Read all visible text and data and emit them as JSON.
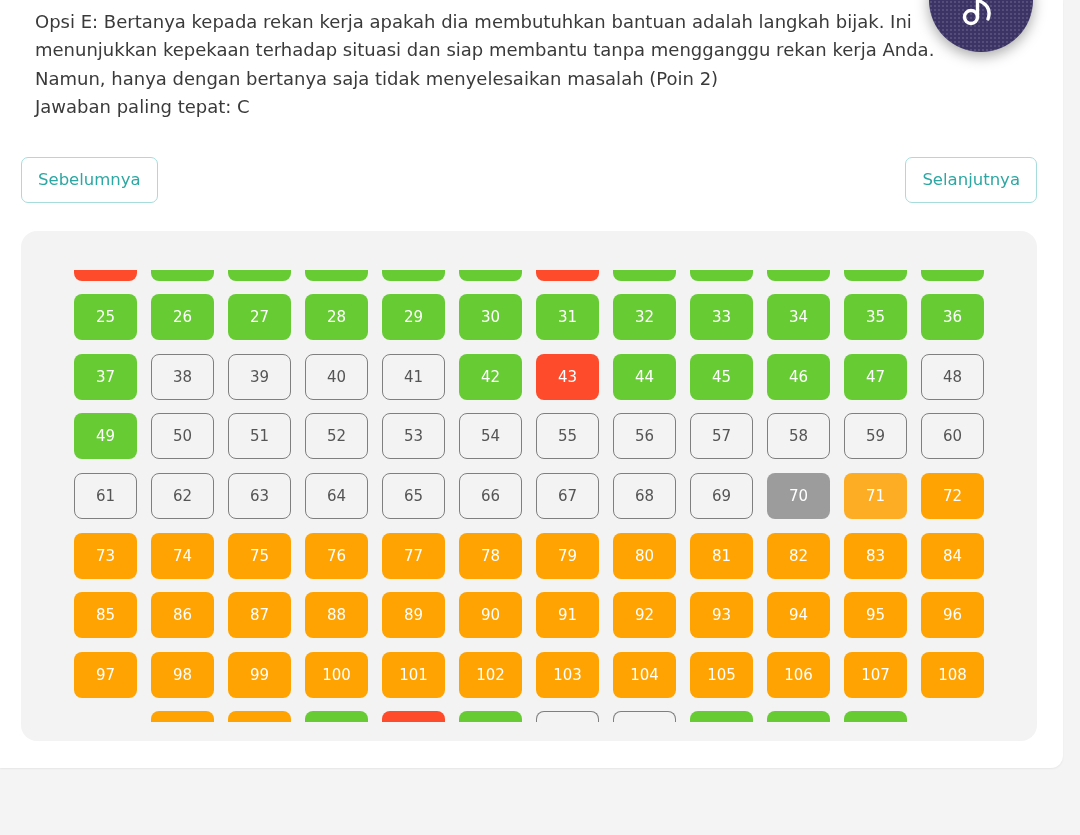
{
  "explanation": {
    "paragraphs": [
      "Opsi E: Bertanya kepada rekan kerja apakah dia membutuhkan bantuan adalah langkah bijak. Ini menunjukkan kepekaan terhadap situasi dan siap membantu tanpa mengganggu rekan kerja Anda. Namun, hanya dengan bertanya saja tidak menyelesaikan masalah (Poin 2)",
      "Jawaban paling tepat: C"
    ]
  },
  "navigation": {
    "previous": "Sebelumnya",
    "next": "Selanjutnya"
  },
  "question_grid": {
    "top_cut_row": [
      {
        "kind": "filled",
        "color": "#fd4b2b"
      },
      {
        "kind": "filled",
        "color": "#67cb34"
      },
      {
        "kind": "filled",
        "color": "#67cb34"
      },
      {
        "kind": "filled",
        "color": "#67cb34"
      },
      {
        "kind": "filled",
        "color": "#67cb34"
      },
      {
        "kind": "filled",
        "color": "#67cb34"
      },
      {
        "kind": "filled",
        "color": "#fd4b2b"
      },
      {
        "kind": "filled",
        "color": "#67cb34"
      },
      {
        "kind": "filled",
        "color": "#67cb34"
      },
      {
        "kind": "filled",
        "color": "#67cb34"
      },
      {
        "kind": "filled",
        "color": "#67cb34"
      },
      {
        "kind": "filled",
        "color": "#67cb34"
      }
    ],
    "tiles": [
      {
        "label": "25",
        "kind": "filled",
        "color": "#67cb34"
      },
      {
        "label": "26",
        "kind": "filled",
        "color": "#67cb34"
      },
      {
        "label": "27",
        "kind": "filled",
        "color": "#67cb34"
      },
      {
        "label": "28",
        "kind": "filled",
        "color": "#67cb34"
      },
      {
        "label": "29",
        "kind": "filled",
        "color": "#67cb34"
      },
      {
        "label": "30",
        "kind": "filled",
        "color": "#67cb34"
      },
      {
        "label": "31",
        "kind": "filled",
        "color": "#67cb34"
      },
      {
        "label": "32",
        "kind": "filled",
        "color": "#67cb34"
      },
      {
        "label": "33",
        "kind": "filled",
        "color": "#67cb34"
      },
      {
        "label": "34",
        "kind": "filled",
        "color": "#67cb34"
      },
      {
        "label": "35",
        "kind": "filled",
        "color": "#67cb34"
      },
      {
        "label": "36",
        "kind": "filled",
        "color": "#67cb34"
      },
      {
        "label": "37",
        "kind": "filled",
        "color": "#67cb34"
      },
      {
        "label": "38",
        "kind": "outline",
        "color": "#7f7f7f"
      },
      {
        "label": "39",
        "kind": "outline",
        "color": "#7f7f7f"
      },
      {
        "label": "40",
        "kind": "outline",
        "color": "#7f7f7f"
      },
      {
        "label": "41",
        "kind": "outline",
        "color": "#7f7f7f"
      },
      {
        "label": "42",
        "kind": "filled",
        "color": "#67cb34"
      },
      {
        "label": "43",
        "kind": "filled",
        "color": "#fd4b2b"
      },
      {
        "label": "44",
        "kind": "filled",
        "color": "#67cb34"
      },
      {
        "label": "45",
        "kind": "filled",
        "color": "#67cb34"
      },
      {
        "label": "46",
        "kind": "filled",
        "color": "#67cb34"
      },
      {
        "label": "47",
        "kind": "filled",
        "color": "#67cb34"
      },
      {
        "label": "48",
        "kind": "outline",
        "color": "#7f7f7f"
      },
      {
        "label": "49",
        "kind": "filled",
        "color": "#67cb34"
      },
      {
        "label": "50",
        "kind": "outline",
        "color": "#7f7f7f"
      },
      {
        "label": "51",
        "kind": "outline",
        "color": "#7f7f7f"
      },
      {
        "label": "52",
        "kind": "outline",
        "color": "#7f7f7f"
      },
      {
        "label": "53",
        "kind": "outline",
        "color": "#7f7f7f"
      },
      {
        "label": "54",
        "kind": "outline",
        "color": "#7f7f7f"
      },
      {
        "label": "55",
        "kind": "outline",
        "color": "#7f7f7f"
      },
      {
        "label": "56",
        "kind": "outline",
        "color": "#7f7f7f"
      },
      {
        "label": "57",
        "kind": "outline",
        "color": "#7f7f7f"
      },
      {
        "label": "58",
        "kind": "outline",
        "color": "#7f7f7f"
      },
      {
        "label": "59",
        "kind": "outline",
        "color": "#7f7f7f"
      },
      {
        "label": "60",
        "kind": "outline",
        "color": "#7f7f7f"
      },
      {
        "label": "61",
        "kind": "outline",
        "color": "#7f7f7f"
      },
      {
        "label": "62",
        "kind": "outline",
        "color": "#7f7f7f"
      },
      {
        "label": "63",
        "kind": "outline",
        "color": "#7f7f7f"
      },
      {
        "label": "64",
        "kind": "outline",
        "color": "#7f7f7f"
      },
      {
        "label": "65",
        "kind": "outline",
        "color": "#7f7f7f"
      },
      {
        "label": "66",
        "kind": "outline",
        "color": "#7f7f7f"
      },
      {
        "label": "67",
        "kind": "outline",
        "color": "#7f7f7f"
      },
      {
        "label": "68",
        "kind": "outline",
        "color": "#7f7f7f"
      },
      {
        "label": "69",
        "kind": "outline",
        "color": "#7f7f7f"
      },
      {
        "label": "70",
        "kind": "filled",
        "color": "#9c9c9c"
      },
      {
        "label": "71",
        "kind": "filled",
        "color": "#fdad24"
      },
      {
        "label": "72",
        "kind": "filled",
        "color": "#ffa302"
      },
      {
        "label": "73",
        "kind": "filled",
        "color": "#ffa302"
      },
      {
        "label": "74",
        "kind": "filled",
        "color": "#ffa302"
      },
      {
        "label": "75",
        "kind": "filled",
        "color": "#ffa302"
      },
      {
        "label": "76",
        "kind": "filled",
        "color": "#ffa302"
      },
      {
        "label": "77",
        "kind": "filled",
        "color": "#ffa302"
      },
      {
        "label": "78",
        "kind": "filled",
        "color": "#ffa302"
      },
      {
        "label": "79",
        "kind": "filled",
        "color": "#ffa302"
      },
      {
        "label": "80",
        "kind": "filled",
        "color": "#ffa302"
      },
      {
        "label": "81",
        "kind": "filled",
        "color": "#ffa302"
      },
      {
        "label": "82",
        "kind": "filled",
        "color": "#ffa302"
      },
      {
        "label": "83",
        "kind": "filled",
        "color": "#ffa302"
      },
      {
        "label": "84",
        "kind": "filled",
        "color": "#ffa302"
      },
      {
        "label": "85",
        "kind": "filled",
        "color": "#ffa302"
      },
      {
        "label": "86",
        "kind": "filled",
        "color": "#ffa302"
      },
      {
        "label": "87",
        "kind": "filled",
        "color": "#ffa302"
      },
      {
        "label": "88",
        "kind": "filled",
        "color": "#ffa302"
      },
      {
        "label": "89",
        "kind": "filled",
        "color": "#ffa302"
      },
      {
        "label": "90",
        "kind": "filled",
        "color": "#ffa302"
      },
      {
        "label": "91",
        "kind": "filled",
        "color": "#ffa302"
      },
      {
        "label": "92",
        "kind": "filled",
        "color": "#ffa302"
      },
      {
        "label": "93",
        "kind": "filled",
        "color": "#ffa302"
      },
      {
        "label": "94",
        "kind": "filled",
        "color": "#ffa302"
      },
      {
        "label": "95",
        "kind": "filled",
        "color": "#ffa302"
      },
      {
        "label": "96",
        "kind": "filled",
        "color": "#ffa302"
      },
      {
        "label": "97",
        "kind": "filled",
        "color": "#ffa302"
      },
      {
        "label": "98",
        "kind": "filled",
        "color": "#ffa302"
      },
      {
        "label": "99",
        "kind": "filled",
        "color": "#ffa302"
      },
      {
        "label": "100",
        "kind": "filled",
        "color": "#ffa302"
      },
      {
        "label": "101",
        "kind": "filled",
        "color": "#ffa302"
      },
      {
        "label": "102",
        "kind": "filled",
        "color": "#ffa302"
      },
      {
        "label": "103",
        "kind": "filled",
        "color": "#ffa302"
      },
      {
        "label": "104",
        "kind": "filled",
        "color": "#ffa302"
      },
      {
        "label": "105",
        "kind": "filled",
        "color": "#ffa302"
      },
      {
        "label": "106",
        "kind": "filled",
        "color": "#ffa302"
      },
      {
        "label": "107",
        "kind": "filled",
        "color": "#ffa302"
      },
      {
        "label": "108",
        "kind": "filled",
        "color": "#ffa302"
      }
    ],
    "bottom_cut_row": [
      {
        "kind": "filled",
        "color": "#ffa302"
      },
      {
        "kind": "filled",
        "color": "#ffa302"
      },
      {
        "kind": "filled",
        "color": "#67cb34"
      },
      {
        "kind": "filled",
        "color": "#fd4b2b"
      },
      {
        "kind": "filled",
        "color": "#67cb34"
      },
      {
        "kind": "outline",
        "color": "#7f7f7f"
      },
      {
        "kind": "outline",
        "color": "#7f7f7f"
      },
      {
        "kind": "filled",
        "color": "#67cb34"
      },
      {
        "kind": "filled",
        "color": "#67cb34"
      },
      {
        "kind": "filled",
        "color": "#67cb34"
      }
    ]
  }
}
